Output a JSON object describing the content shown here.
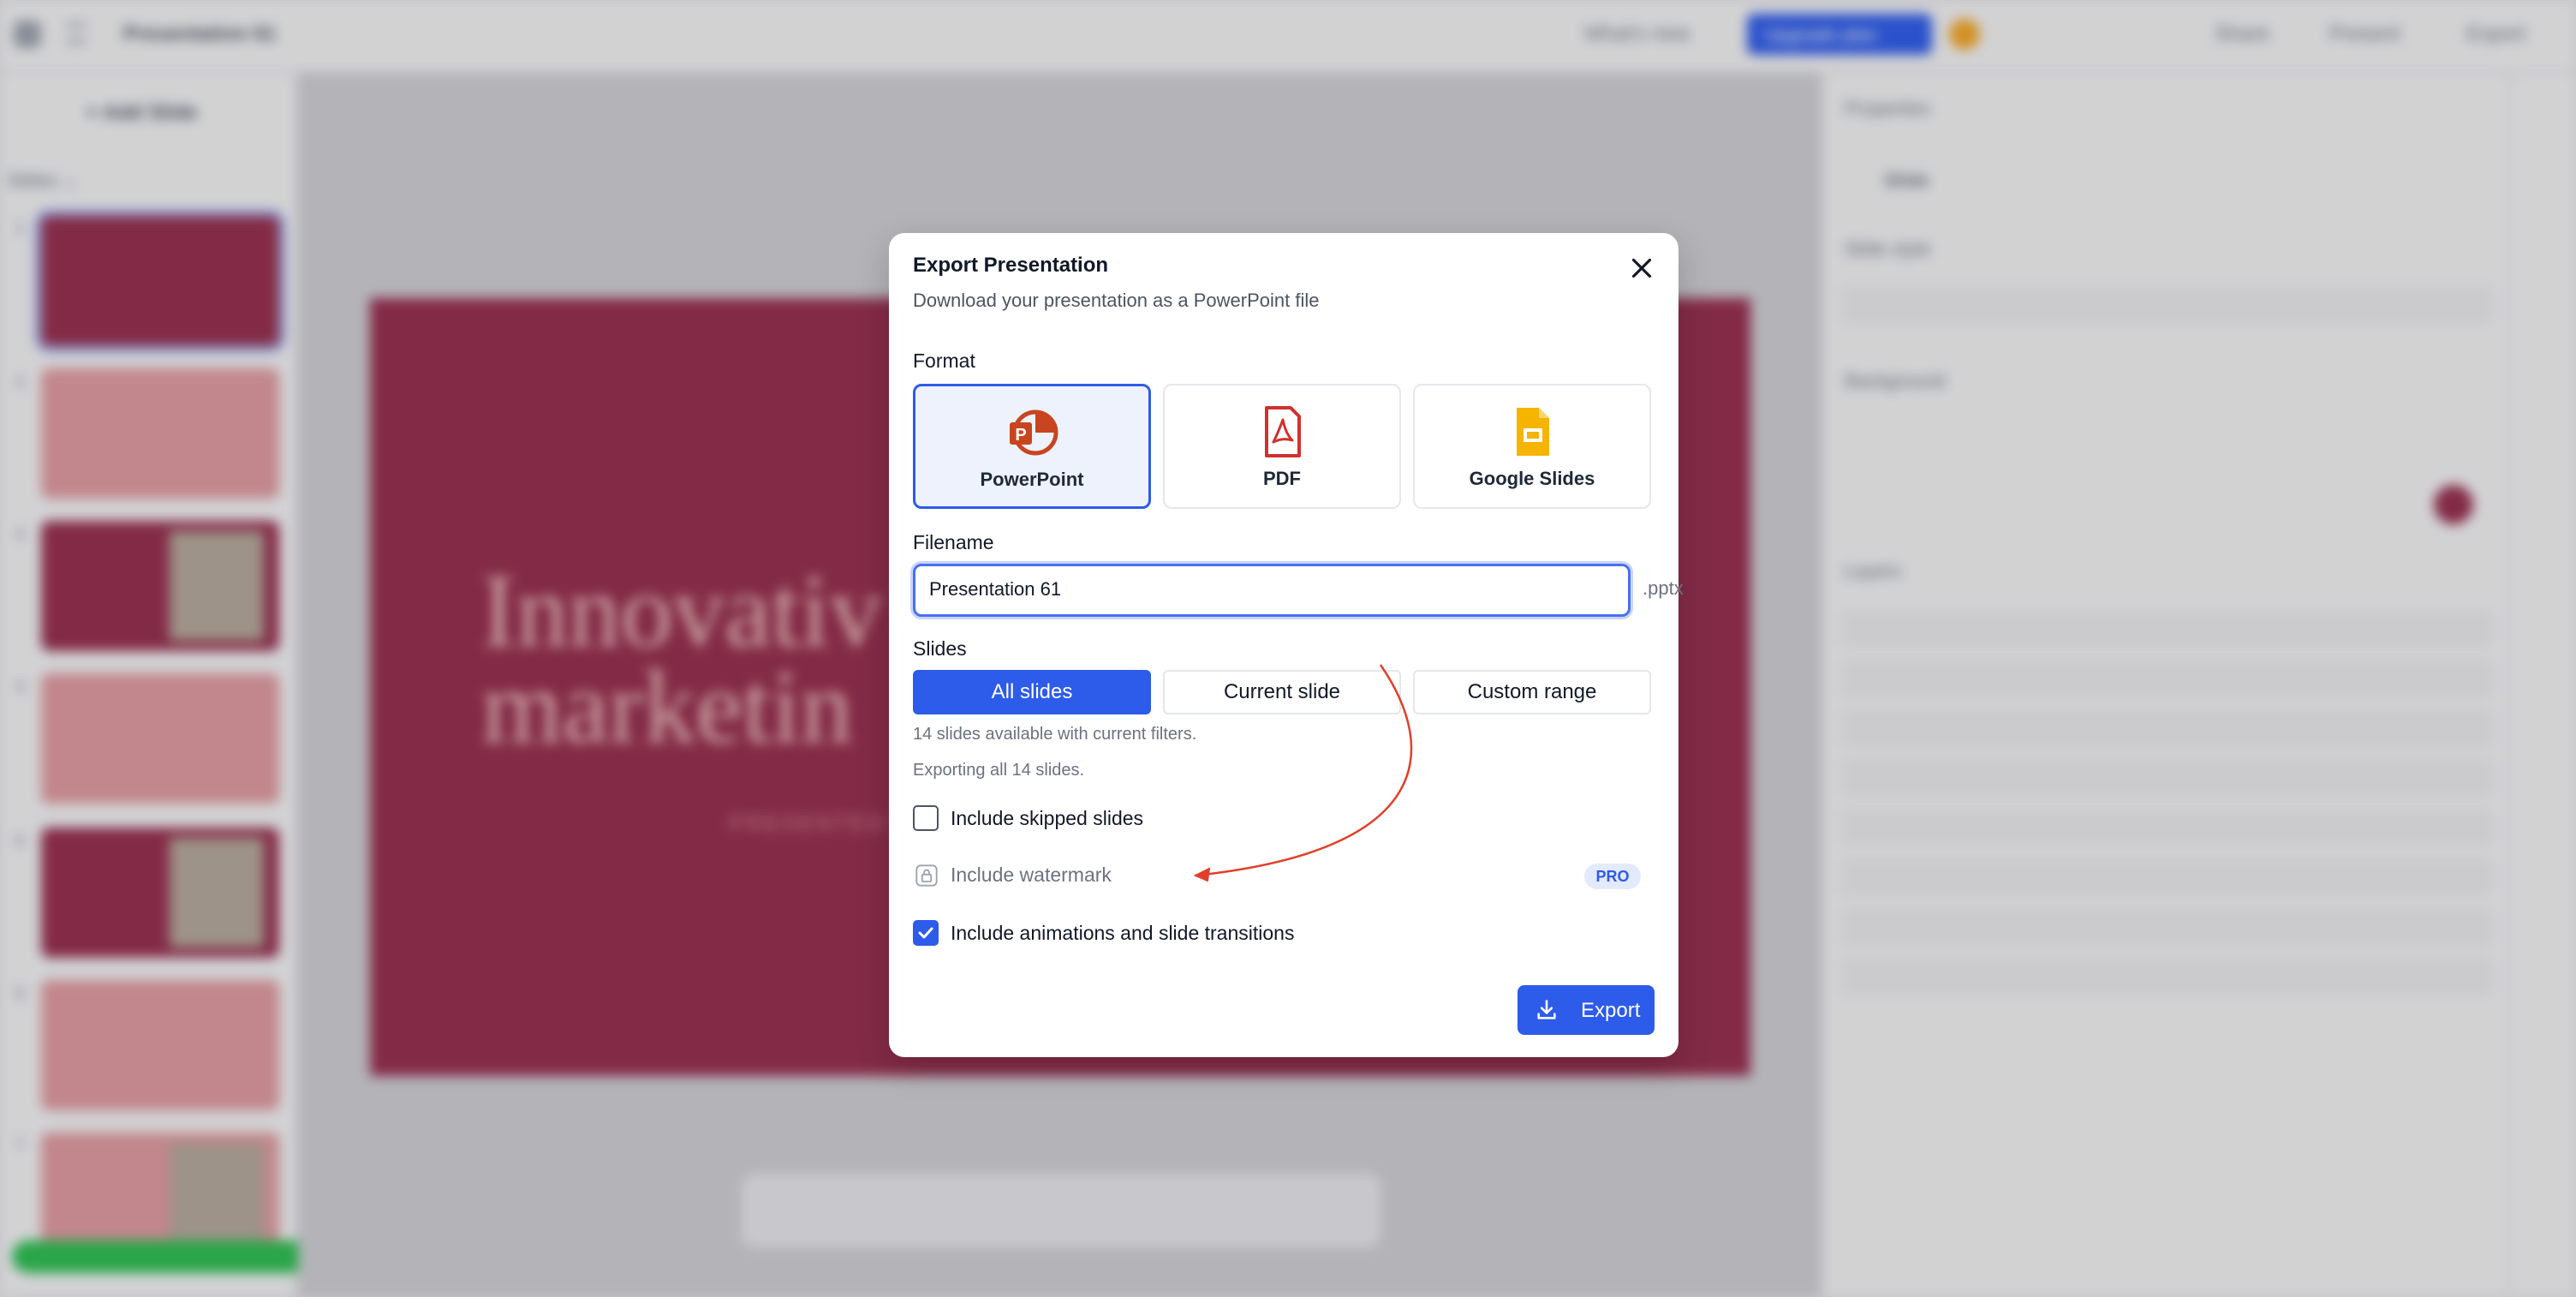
{
  "window": {
    "doc_title": "Presentation 61"
  },
  "topbar": {
    "whats_new": "What's new",
    "cta": "Upgrade plan",
    "share": "Share",
    "present": "Present",
    "export": "Export"
  },
  "left_panel": {
    "add_slide": "+ Add Slide",
    "slides_label": "Slides ⌄"
  },
  "slide_preview": {
    "title_line1": "Innovativ",
    "title_line2": "marketin",
    "subtitle": "PRESENTED BY"
  },
  "right_panel": {
    "title": "Properties",
    "slide_label": "Slide",
    "slide_style": "Slide style",
    "background": "Background",
    "layers": "Layers",
    "fill_color": "#962d4c"
  },
  "modal": {
    "title": "Export Presentation",
    "subtitle": "Download your presentation as a PowerPoint file",
    "format_label": "Format",
    "formats": [
      {
        "name": "PowerPoint",
        "icon": "powerpoint-icon",
        "selected": true
      },
      {
        "name": "PDF",
        "icon": "pdf-icon",
        "selected": false
      },
      {
        "name": "Google Slides",
        "icon": "google-slides-icon",
        "selected": false
      }
    ],
    "filename_label": "Filename",
    "filename_value": "Presentation 61",
    "extension": ".pptx",
    "slides_label": "Slides",
    "slide_options": [
      {
        "label": "All slides",
        "selected": true
      },
      {
        "label": "Current slide",
        "selected": false
      },
      {
        "label": "Custom range",
        "selected": false
      }
    ],
    "available_note": "14 slides available with current filters.",
    "exporting_note": "Exporting all 14 slides.",
    "include_skipped": {
      "label": "Include skipped slides",
      "checked": false
    },
    "include_watermark": {
      "label": "Include watermark",
      "locked": true,
      "badge": "PRO"
    },
    "include_animations": {
      "label": "Include animations and slide transitions",
      "checked": true
    },
    "export_button": "Export",
    "accent_color": "#2d5bea",
    "annotation_color": "#e0402a"
  }
}
